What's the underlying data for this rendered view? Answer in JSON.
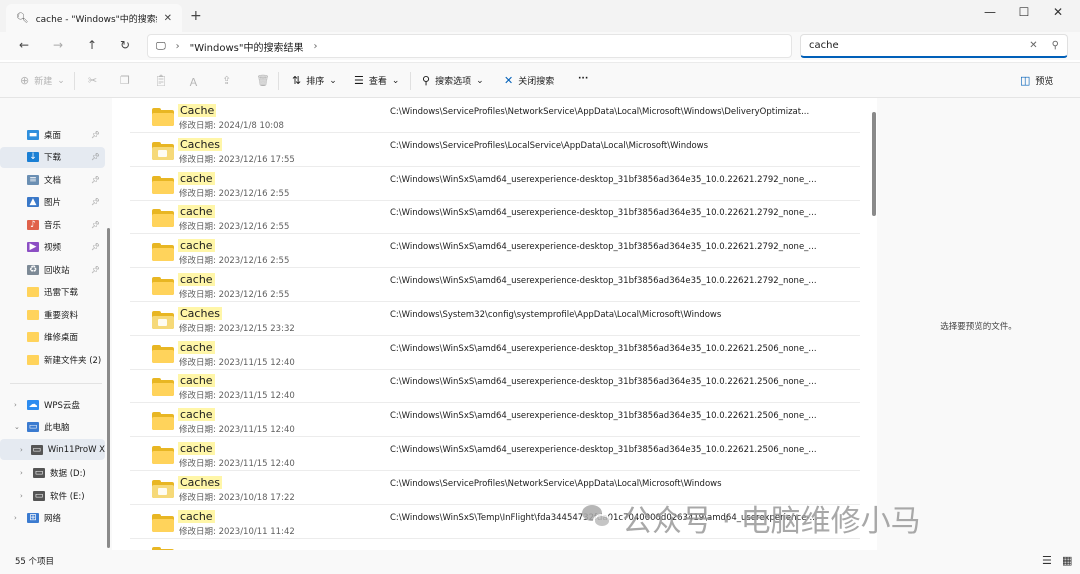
{
  "window": {
    "tab_title": "cache - \"Windows\"中的搜索结",
    "tab_close": "✕",
    "new_tab": "+",
    "controls": [
      "—",
      "☐",
      "✕"
    ]
  },
  "nav": {
    "address": "\"Windows\"中的搜索结果",
    "search_value": "cache",
    "search_clear": "✕"
  },
  "toolbar": {
    "new_label": "新建",
    "sort_label": "排序",
    "view_label": "查看",
    "search_options_label": "搜索选项",
    "close_search_label": "关闭搜索",
    "more_label": "···",
    "preview_label": "预览"
  },
  "sidebar": {
    "quick_access": [
      {
        "label": "桌面",
        "icon": "desktop-icon",
        "color": "#2f8fdd"
      },
      {
        "label": "下载",
        "icon": "download-icon",
        "color": "#1a7fd4"
      },
      {
        "label": "文档",
        "icon": "document-icon",
        "color": "#6b8fb3"
      },
      {
        "label": "图片",
        "icon": "picture-icon",
        "color": "#3a78c8"
      },
      {
        "label": "音乐",
        "icon": "music-icon",
        "color": "#e0624b"
      },
      {
        "label": "视频",
        "icon": "video-icon",
        "color": "#8c4fc4"
      },
      {
        "label": "回收站",
        "icon": "recycle-bin-icon",
        "color": "#7d8a96"
      },
      {
        "label": "迅雷下载",
        "icon": "folder-icon",
        "color": "#ffd35b"
      },
      {
        "label": "重要资料",
        "icon": "folder-icon",
        "color": "#ffd35b"
      },
      {
        "label": "维修桌面",
        "icon": "folder-icon",
        "color": "#ffd35b"
      },
      {
        "label": "新建文件夹 (2)",
        "icon": "folder-icon",
        "color": "#ffd35b"
      }
    ],
    "locations": [
      {
        "label": "WPS云盘",
        "icon": "cloud-icon",
        "color": "#2d8cf0"
      },
      {
        "label": "此电脑",
        "icon": "computer-icon",
        "color": "#3b7bd0"
      },
      {
        "label": "Win11ProW X",
        "icon": "drive-icon",
        "color": "#555555"
      },
      {
        "label": "数据 (D:)",
        "icon": "drive-icon",
        "color": "#555555"
      },
      {
        "label": "软件 (E:)",
        "icon": "drive-icon",
        "color": "#555555"
      },
      {
        "label": "网络",
        "icon": "network-icon",
        "color": "#3b7bd0"
      }
    ]
  },
  "results": [
    {
      "name": "Cache",
      "date": "修改日期: 2024/1/8 10:08",
      "path": "C:\\Windows\\ServiceProfiles\\NetworkService\\AppData\\Local\\Microsoft\\Windows\\DeliveryOptimizat...",
      "sync": false
    },
    {
      "name": "Caches",
      "date": "修改日期: 2023/12/16 17:55",
      "path": "C:\\Windows\\ServiceProfiles\\LocalService\\AppData\\Local\\Microsoft\\Windows",
      "sync": true
    },
    {
      "name": "cache",
      "date": "修改日期: 2023/12/16 2:55",
      "path": "C:\\Windows\\WinSxS\\amd64_userexperience-desktop_31bf3856ad364e35_10.0.22621.2792_none_...",
      "sync": false
    },
    {
      "name": "cache",
      "date": "修改日期: 2023/12/16 2:55",
      "path": "C:\\Windows\\WinSxS\\amd64_userexperience-desktop_31bf3856ad364e35_10.0.22621.2792_none_...",
      "sync": false
    },
    {
      "name": "cache",
      "date": "修改日期: 2023/12/16 2:55",
      "path": "C:\\Windows\\WinSxS\\amd64_userexperience-desktop_31bf3856ad364e35_10.0.22621.2792_none_...",
      "sync": false
    },
    {
      "name": "cache",
      "date": "修改日期: 2023/12/16 2:55",
      "path": "C:\\Windows\\WinSxS\\amd64_userexperience-desktop_31bf3856ad364e35_10.0.22621.2792_none_...",
      "sync": false
    },
    {
      "name": "Caches",
      "date": "修改日期: 2023/12/15 23:32",
      "path": "C:\\Windows\\System32\\config\\systemprofile\\AppData\\Local\\Microsoft\\Windows",
      "sync": true
    },
    {
      "name": "cache",
      "date": "修改日期: 2023/11/15 12:40",
      "path": "C:\\Windows\\WinSxS\\amd64_userexperience-desktop_31bf3856ad364e35_10.0.22621.2506_none_...",
      "sync": false
    },
    {
      "name": "cache",
      "date": "修改日期: 2023/11/15 12:40",
      "path": "C:\\Windows\\WinSxS\\amd64_userexperience-desktop_31bf3856ad364e35_10.0.22621.2506_none_...",
      "sync": false
    },
    {
      "name": "cache",
      "date": "修改日期: 2023/11/15 12:40",
      "path": "C:\\Windows\\WinSxS\\amd64_userexperience-desktop_31bf3856ad364e35_10.0.22621.2506_none_...",
      "sync": false
    },
    {
      "name": "cache",
      "date": "修改日期: 2023/11/15 12:40",
      "path": "C:\\Windows\\WinSxS\\amd64_userexperience-desktop_31bf3856ad364e35_10.0.22621.2506_none_...",
      "sync": false
    },
    {
      "name": "Caches",
      "date": "修改日期: 2023/10/18 17:22",
      "path": "C:\\Windows\\ServiceProfiles\\NetworkService\\AppData\\Local\\Microsoft\\Windows",
      "sync": true
    },
    {
      "name": "cache",
      "date": "修改日期: 2023/10/11 11:42",
      "path": "C:\\Windows\\WinSxS\\Temp\\InFlight\\fda34454732fda01c7040000d0263419\\amd64_userexperience-...",
      "sync": false
    }
  ],
  "preview": {
    "message": "选择要预览的文件。"
  },
  "status": {
    "count": "55 个项目"
  },
  "watermark": {
    "text": "公众号 · 电脑维修小马"
  },
  "colors": {
    "accent": "#005fb8",
    "highlight": "#fff6a8",
    "folder": "#ffd35b"
  }
}
